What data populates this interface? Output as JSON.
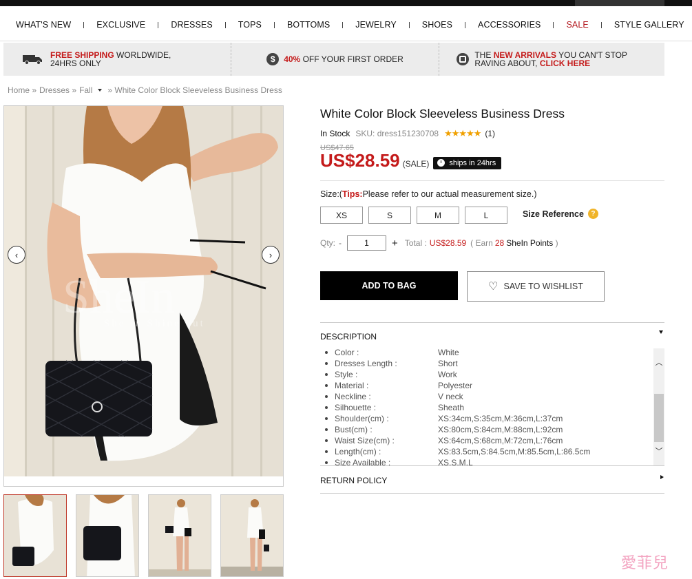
{
  "nav": {
    "items": [
      "WHAT'S NEW",
      "EXCLUSIVE",
      "DRESSES",
      "TOPS",
      "BOTTOMS",
      "JEWELRY",
      "SHOES",
      "ACCESSORIES",
      "SALE",
      "STYLE GALLERY"
    ]
  },
  "promo": {
    "shipping_bold": "FREE SHIPPING",
    "shipping_rest": " WORLDWIDE,",
    "shipping_line2": "24HRS ONLY",
    "discount_bold": "40%",
    "discount_rest": " OFF YOUR FIRST ORDER",
    "arrivals_pre": "THE ",
    "arrivals_bold": "NEW ARRIVALS",
    "arrivals_rest": " YOU CAN'T STOP",
    "arrivals_line2": "RAVING ABOUT, ",
    "arrivals_link": "CLICK HERE",
    "dollar_symbol": "$"
  },
  "breadcrumb": {
    "home": "Home »",
    "dresses": "Dresses »",
    "fall": "Fall",
    "current": "» White Color Block Sleeveless Business Dress"
  },
  "gallery": {
    "prev_icon": "chevron-left-icon",
    "next_icon": "chevron-right-icon",
    "prev_glyph": "‹",
    "next_glyph": "›",
    "watermark_logo": "SheIn",
    "watermark_tag": "She in   Shine out"
  },
  "product": {
    "title": "White Color Block Sleeveless Business Dress",
    "stock": "In Stock",
    "sku": "SKU:  dress151230708",
    "stars": "★★★★★",
    "reviews": "(1)",
    "old_price": "US$47.65",
    "price": "US$28.59",
    "sale": "(SALE)",
    "ships": "ships in 24hrs"
  },
  "size": {
    "label": "Size:(",
    "tips": "Tips:",
    "tips_text": "Please refer to our actual measurement size.)",
    "options": [
      "XS",
      "S",
      "M",
      "L"
    ],
    "reference": "Size Reference",
    "q": "?"
  },
  "qty": {
    "label": "Qty:",
    "minus": "-",
    "value": "1",
    "plus": "+",
    "total_label": "Total :",
    "total_value": "US$28.59",
    "earn_pre": "( Earn",
    "earn_points": "28",
    "earn_post": "SheIn Points",
    "earn_close": " )"
  },
  "actions": {
    "add_to_bag": "ADD TO BAG",
    "wishlist": "SAVE TO WISHLIST",
    "heart": "♡"
  },
  "description": {
    "heading": "DESCRIPTION",
    "rows": [
      {
        "k": "Color :",
        "v": "White"
      },
      {
        "k": "Dresses Length :",
        "v": "Short"
      },
      {
        "k": "Style :",
        "v": "Work"
      },
      {
        "k": "Material :",
        "v": "Polyester"
      },
      {
        "k": "Neckline :",
        "v": "V neck"
      },
      {
        "k": "Silhouette :",
        "v": "Sheath"
      },
      {
        "k": "Shoulder(cm) :",
        "v": "XS:34cm,S:35cm,M:36cm,L:37cm"
      },
      {
        "k": "Bust(cm) :",
        "v": "XS:80cm,S:84cm,M:88cm,L:92cm"
      },
      {
        "k": "Waist Size(cm) :",
        "v": "XS:64cm,S:68cm,M:72cm,L:76cm"
      },
      {
        "k": "Length(cm) :",
        "v": "XS:83.5cm,S:84.5cm,M:85.5cm,L:86.5cm"
      },
      {
        "k": "Size Available :",
        "v": "XS,S,M,L"
      }
    ],
    "scroll_up": "︿",
    "scroll_down": "﹀"
  },
  "return_policy": "RETURN POLICY",
  "watermark": "愛菲兒",
  "colors": {
    "accent_red": "#c41a1a",
    "black": "#000000"
  }
}
